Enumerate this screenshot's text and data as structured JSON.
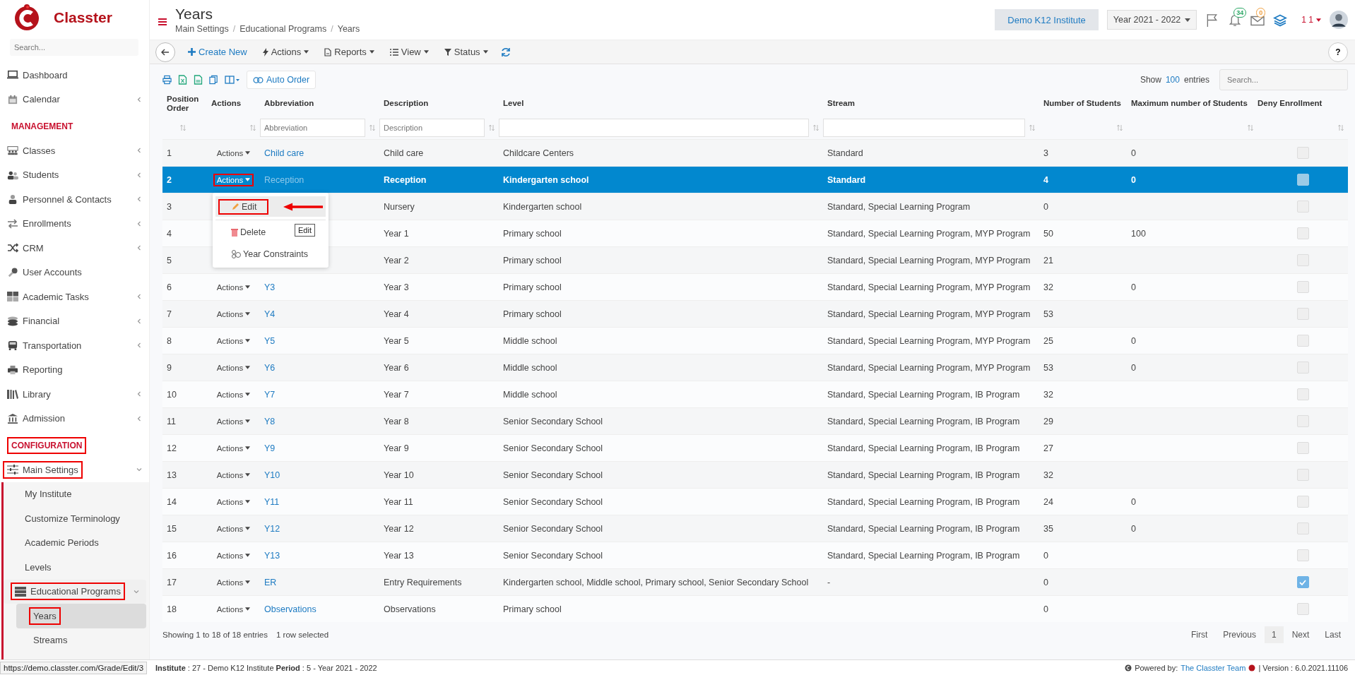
{
  "brand": {
    "name": "Classter"
  },
  "sidebar": {
    "search_placeholder": "Search...",
    "items": [
      {
        "kind": "link",
        "label": "Dashboard",
        "selected": false
      },
      {
        "kind": "link",
        "label": "Calendar",
        "expandable": true,
        "expanded": false,
        "selected": false
      },
      {
        "kind": "heading",
        "label": "MANAGEMENT",
        "highlighted": false
      },
      {
        "kind": "link",
        "label": "Classes",
        "expandable": true,
        "expanded": false,
        "selected": false
      },
      {
        "kind": "link",
        "label": "Students",
        "expandable": true,
        "expanded": false,
        "selected": false
      },
      {
        "kind": "link",
        "label": "Personnel & Contacts",
        "expandable": true,
        "expanded": false,
        "selected": false
      },
      {
        "kind": "link",
        "label": "Enrollments",
        "expandable": true,
        "expanded": false,
        "selected": false
      },
      {
        "kind": "link",
        "label": "CRM",
        "expandable": true,
        "expanded": false,
        "selected": false
      },
      {
        "kind": "link",
        "label": "User Accounts",
        "selected": false
      },
      {
        "kind": "link",
        "label": "Academic Tasks",
        "expandable": true,
        "expanded": false,
        "selected": false
      },
      {
        "kind": "link",
        "label": "Financial",
        "expandable": true,
        "expanded": false,
        "selected": false
      },
      {
        "kind": "link",
        "label": "Transportation",
        "expandable": true,
        "expanded": false,
        "selected": false
      },
      {
        "kind": "link",
        "label": "Reporting",
        "selected": false
      },
      {
        "kind": "link",
        "label": "Library",
        "expandable": true,
        "expanded": false,
        "selected": false
      },
      {
        "kind": "link",
        "label": "Admission",
        "expandable": true,
        "expanded": false,
        "selected": false
      },
      {
        "kind": "heading",
        "label": "CONFIGURATION",
        "highlighted": true
      },
      {
        "kind": "link",
        "label": "Main Settings",
        "expandable": true,
        "expanded": true,
        "selected": false,
        "highlighted": true,
        "children": [
          {
            "kind": "link",
            "label": "My Institute",
            "selected": false
          },
          {
            "kind": "link",
            "label": "Customize Terminology",
            "selected": false
          },
          {
            "kind": "link",
            "label": "Academic Periods",
            "selected": false
          },
          {
            "kind": "link",
            "label": "Levels",
            "selected": false
          },
          {
            "kind": "link",
            "label": "Educational Programs",
            "expandable": true,
            "expanded": true,
            "selected": false,
            "highlighted": true,
            "children": [
              {
                "kind": "link",
                "label": "Years",
                "selected": true,
                "highlighted": true
              },
              {
                "kind": "link",
                "label": "Streams",
                "selected": false
              }
            ]
          }
        ]
      }
    ]
  },
  "header": {
    "title": "Years",
    "breadcrumb": [
      "Main Settings",
      "Educational Programs",
      "Years"
    ],
    "breadcrumb_separator": "/",
    "institute": "Demo K12 Institute",
    "year": "Year 2021 - 2022",
    "notifications": "34",
    "messages": "0",
    "user": "1 1"
  },
  "toolbar": {
    "buttons": [
      {
        "kind": "create",
        "label": "Create New"
      },
      {
        "kind": "actions",
        "label": "Actions"
      },
      {
        "kind": "reports",
        "label": "Reports"
      },
      {
        "kind": "view",
        "label": "View"
      },
      {
        "kind": "status",
        "label": "Status"
      }
    ],
    "help": "?"
  },
  "table_tools": {
    "auto_order": "Auto Order",
    "show": "Show",
    "page_size": "100",
    "entries": "entries",
    "search_placeholder": "Search..."
  },
  "table": {
    "columns": [
      "Position Order",
      "Actions",
      "Abbreviation",
      "Description",
      "Level",
      "Stream",
      "Number of Students",
      "Maximum number of Students",
      "Deny Enrollment"
    ],
    "filters": [
      {
        "kind": "none"
      },
      {
        "kind": "none"
      },
      {
        "kind": "text",
        "placeholder": "Abbreviation"
      },
      {
        "kind": "text",
        "placeholder": "Description"
      },
      {
        "kind": "text"
      },
      {
        "kind": "text"
      },
      {
        "kind": "none"
      },
      {
        "kind": "none"
      },
      {
        "kind": "none"
      }
    ],
    "rows": [
      {
        "order": "1",
        "actions": "Actions",
        "abbreviation": "Child care",
        "description": "Child care",
        "level": "Childcare Centers",
        "stream": "Standard",
        "students": "3",
        "max_students": "0",
        "deny_enrollment": false,
        "selected": false
      },
      {
        "order": "2",
        "actions": "Actions",
        "actions_highlighted": true,
        "abbreviation": "Reception",
        "description": "Reception",
        "level": "Kindergarten school",
        "stream": "Standard",
        "students": "4",
        "max_students": "0",
        "deny_enrollment": false,
        "selected": true,
        "menu": {
          "items": [
            {
              "kind": "edit",
              "label": "Edit",
              "hovered": true,
              "highlighted": true,
              "arrow": true
            },
            {
              "kind": "delete",
              "label": "Delete",
              "separated": true
            },
            {
              "kind": "constraints",
              "label": "Year Constraints"
            }
          ],
          "tooltip": "Edit"
        }
      },
      {
        "order": "3",
        "description": "Nursery",
        "level": "Kindergarten school",
        "stream": "Standard, Special Learning Program",
        "students": "0",
        "deny_enrollment": false,
        "selected": false
      },
      {
        "order": "4",
        "description": "Year 1",
        "level": "Primary school",
        "stream": "Standard, Special Learning Program, MYP Program",
        "students": "50",
        "max_students": "100",
        "deny_enrollment": false,
        "selected": false
      },
      {
        "order": "5",
        "description": "Year 2",
        "level": "Primary school",
        "stream": "Standard, Special Learning Program, MYP Program",
        "students": "21",
        "deny_enrollment": false,
        "selected": false
      },
      {
        "order": "6",
        "actions": "Actions",
        "abbreviation": "Y3",
        "description": "Year 3",
        "level": "Primary school",
        "stream": "Standard, Special Learning Program, MYP Program",
        "students": "32",
        "max_students": "0",
        "deny_enrollment": false,
        "selected": false
      },
      {
        "order": "7",
        "actions": "Actions",
        "abbreviation": "Y4",
        "description": "Year 4",
        "level": "Primary school",
        "stream": "Standard, Special Learning Program, MYP Program",
        "students": "53",
        "deny_enrollment": false,
        "selected": false
      },
      {
        "order": "8",
        "actions": "Actions",
        "abbreviation": "Y5",
        "description": "Year 5",
        "level": "Middle school",
        "stream": "Standard, Special Learning Program, MYP Program",
        "students": "25",
        "max_students": "0",
        "deny_enrollment": false,
        "selected": false
      },
      {
        "order": "9",
        "actions": "Actions",
        "abbreviation": "Y6",
        "description": "Year 6",
        "level": "Middle school",
        "stream": "Standard, Special Learning Program, MYP Program",
        "students": "53",
        "max_students": "0",
        "deny_enrollment": false,
        "selected": false
      },
      {
        "order": "10",
        "actions": "Actions",
        "abbreviation": "Y7",
        "description": "Year 7",
        "level": "Middle school",
        "stream": "Standard, Special Learning Program, IB Program",
        "students": "32",
        "deny_enrollment": false,
        "selected": false
      },
      {
        "order": "11",
        "actions": "Actions",
        "abbreviation": "Y8",
        "description": "Year 8",
        "level": "Senior Secondary School",
        "stream": "Standard, Special Learning Program, IB Program",
        "students": "29",
        "deny_enrollment": false,
        "selected": false
      },
      {
        "order": "12",
        "actions": "Actions",
        "abbreviation": "Y9",
        "description": "Year 9",
        "level": "Senior Secondary School",
        "stream": "Standard, Special Learning Program, IB Program",
        "students": "27",
        "deny_enrollment": false,
        "selected": false
      },
      {
        "order": "13",
        "actions": "Actions",
        "abbreviation": "Y10",
        "description": "Year 10",
        "level": "Senior Secondary School",
        "stream": "Standard, Special Learning Program, IB Program",
        "students": "32",
        "deny_enrollment": false,
        "selected": false
      },
      {
        "order": "14",
        "actions": "Actions",
        "abbreviation": "Y11",
        "description": "Year 11",
        "level": "Senior Secondary School",
        "stream": "Standard, Special Learning Program, IB Program",
        "students": "24",
        "max_students": "0",
        "deny_enrollment": false,
        "selected": false
      },
      {
        "order": "15",
        "actions": "Actions",
        "abbreviation": "Y12",
        "description": "Year 12",
        "level": "Senior Secondary School",
        "stream": "Standard, Special Learning Program, IB Program",
        "students": "35",
        "max_students": "0",
        "deny_enrollment": false,
        "selected": false
      },
      {
        "order": "16",
        "actions": "Actions",
        "abbreviation": "Y13",
        "description": "Year 13",
        "level": "Senior Secondary School",
        "stream": "Standard, Special Learning Program, IB Program",
        "students": "0",
        "deny_enrollment": false,
        "selected": false
      },
      {
        "order": "17",
        "actions": "Actions",
        "abbreviation": "ER",
        "description": "Entry Requirements",
        "level": "Kindergarten school, Middle school, Primary school, Senior Secondary School",
        "stream": "-",
        "students": "0",
        "deny_enrollment": true,
        "selected": false
      },
      {
        "order": "18",
        "actions": "Actions",
        "abbreviation": "Observations",
        "description": "Observations",
        "level": "Primary school",
        "students": "0",
        "deny_enrollment": false,
        "selected": false
      }
    ]
  },
  "pagination": {
    "summary": "Showing 1 to 18 of 18 entries",
    "selection": "1 row selected",
    "pages": [
      {
        "label": "First",
        "selected": false
      },
      {
        "label": "Previous",
        "selected": false
      },
      {
        "label": "1",
        "selected": true
      },
      {
        "label": "Next",
        "selected": false
      },
      {
        "label": "Last",
        "selected": false
      }
    ]
  },
  "status_bar": {
    "url": "https://demo.classter.com/Grade/Edit/3",
    "info": "**Institute** : 27 - Demo K12 Institute **Period** : 5 - Year 2021 - 2022",
    "powered_by": "Powered by:",
    "team": "The Classter Team",
    "version": "| Version : 6.0.2021.11106"
  }
}
